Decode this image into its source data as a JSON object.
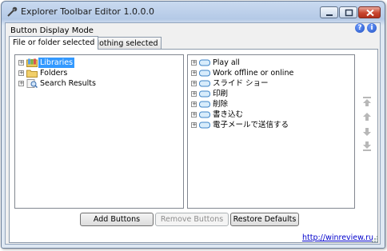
{
  "window": {
    "title": "Explorer Toolbar Editor 1.0.0.0"
  },
  "header": {
    "mode_label": "Button Display Mode",
    "help_icon": "question-icon",
    "info_icon": "info-icon"
  },
  "tabs": [
    {
      "label": "File or folder selected",
      "active": true
    },
    {
      "label": "Nothing selected",
      "active": false
    }
  ],
  "left_tree": [
    {
      "label": "Libraries",
      "icon": "libraries-icon",
      "selected": true
    },
    {
      "label": "Folders",
      "icon": "folder-icon",
      "selected": false
    },
    {
      "label": "Search Results",
      "icon": "search-results-icon",
      "selected": false
    }
  ],
  "right_tree": [
    {
      "label": "Play all",
      "icon": "button-icon"
    },
    {
      "label": "Work offline or online",
      "icon": "button-icon"
    },
    {
      "label": "スライド ショー",
      "icon": "button-icon"
    },
    {
      "label": "印刷",
      "icon": "button-icon"
    },
    {
      "label": "削除",
      "icon": "button-icon"
    },
    {
      "label": "書き込む",
      "icon": "button-icon"
    },
    {
      "label": "電子メールで送信する",
      "icon": "button-icon"
    }
  ],
  "buttons": {
    "add": "Add Buttons",
    "remove": "Remove Buttons",
    "restore": "Restore Defaults"
  },
  "status": {
    "link": "http://winreview.ru"
  },
  "colors": {
    "selection": "#3399ff",
    "link": "#0000cc",
    "disabled_text": "#8d8d8d"
  }
}
